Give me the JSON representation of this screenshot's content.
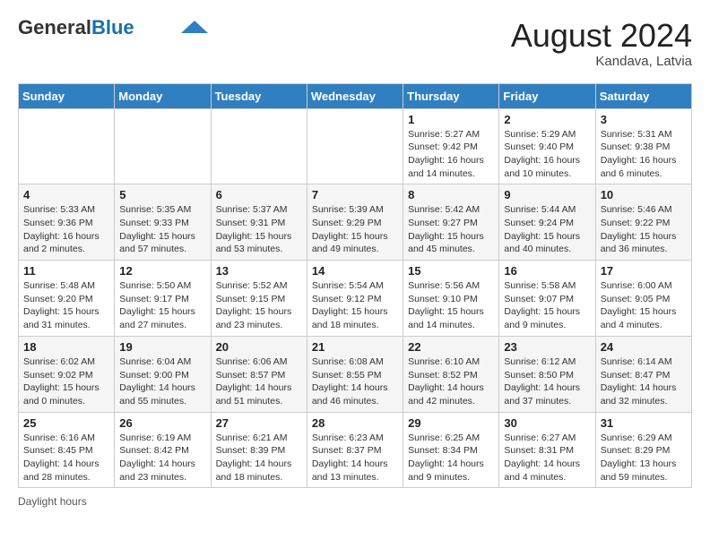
{
  "header": {
    "logo_general": "General",
    "logo_blue": "Blue",
    "month_year": "August 2024",
    "location": "Kandava, Latvia"
  },
  "footer": {
    "daylight_label": "Daylight hours"
  },
  "weekdays": [
    "Sunday",
    "Monday",
    "Tuesday",
    "Wednesday",
    "Thursday",
    "Friday",
    "Saturday"
  ],
  "weeks": [
    [
      {
        "day": "",
        "info": ""
      },
      {
        "day": "",
        "info": ""
      },
      {
        "day": "",
        "info": ""
      },
      {
        "day": "",
        "info": ""
      },
      {
        "day": "1",
        "info": "Sunrise: 5:27 AM\nSunset: 9:42 PM\nDaylight: 16 hours and 14 minutes."
      },
      {
        "day": "2",
        "info": "Sunrise: 5:29 AM\nSunset: 9:40 PM\nDaylight: 16 hours and 10 minutes."
      },
      {
        "day": "3",
        "info": "Sunrise: 5:31 AM\nSunset: 9:38 PM\nDaylight: 16 hours and 6 minutes."
      }
    ],
    [
      {
        "day": "4",
        "info": "Sunrise: 5:33 AM\nSunset: 9:36 PM\nDaylight: 16 hours and 2 minutes."
      },
      {
        "day": "5",
        "info": "Sunrise: 5:35 AM\nSunset: 9:33 PM\nDaylight: 15 hours and 57 minutes."
      },
      {
        "day": "6",
        "info": "Sunrise: 5:37 AM\nSunset: 9:31 PM\nDaylight: 15 hours and 53 minutes."
      },
      {
        "day": "7",
        "info": "Sunrise: 5:39 AM\nSunset: 9:29 PM\nDaylight: 15 hours and 49 minutes."
      },
      {
        "day": "8",
        "info": "Sunrise: 5:42 AM\nSunset: 9:27 PM\nDaylight: 15 hours and 45 minutes."
      },
      {
        "day": "9",
        "info": "Sunrise: 5:44 AM\nSunset: 9:24 PM\nDaylight: 15 hours and 40 minutes."
      },
      {
        "day": "10",
        "info": "Sunrise: 5:46 AM\nSunset: 9:22 PM\nDaylight: 15 hours and 36 minutes."
      }
    ],
    [
      {
        "day": "11",
        "info": "Sunrise: 5:48 AM\nSunset: 9:20 PM\nDaylight: 15 hours and 31 minutes."
      },
      {
        "day": "12",
        "info": "Sunrise: 5:50 AM\nSunset: 9:17 PM\nDaylight: 15 hours and 27 minutes."
      },
      {
        "day": "13",
        "info": "Sunrise: 5:52 AM\nSunset: 9:15 PM\nDaylight: 15 hours and 23 minutes."
      },
      {
        "day": "14",
        "info": "Sunrise: 5:54 AM\nSunset: 9:12 PM\nDaylight: 15 hours and 18 minutes."
      },
      {
        "day": "15",
        "info": "Sunrise: 5:56 AM\nSunset: 9:10 PM\nDaylight: 15 hours and 14 minutes."
      },
      {
        "day": "16",
        "info": "Sunrise: 5:58 AM\nSunset: 9:07 PM\nDaylight: 15 hours and 9 minutes."
      },
      {
        "day": "17",
        "info": "Sunrise: 6:00 AM\nSunset: 9:05 PM\nDaylight: 15 hours and 4 minutes."
      }
    ],
    [
      {
        "day": "18",
        "info": "Sunrise: 6:02 AM\nSunset: 9:02 PM\nDaylight: 15 hours and 0 minutes."
      },
      {
        "day": "19",
        "info": "Sunrise: 6:04 AM\nSunset: 9:00 PM\nDaylight: 14 hours and 55 minutes."
      },
      {
        "day": "20",
        "info": "Sunrise: 6:06 AM\nSunset: 8:57 PM\nDaylight: 14 hours and 51 minutes."
      },
      {
        "day": "21",
        "info": "Sunrise: 6:08 AM\nSunset: 8:55 PM\nDaylight: 14 hours and 46 minutes."
      },
      {
        "day": "22",
        "info": "Sunrise: 6:10 AM\nSunset: 8:52 PM\nDaylight: 14 hours and 42 minutes."
      },
      {
        "day": "23",
        "info": "Sunrise: 6:12 AM\nSunset: 8:50 PM\nDaylight: 14 hours and 37 minutes."
      },
      {
        "day": "24",
        "info": "Sunrise: 6:14 AM\nSunset: 8:47 PM\nDaylight: 14 hours and 32 minutes."
      }
    ],
    [
      {
        "day": "25",
        "info": "Sunrise: 6:16 AM\nSunset: 8:45 PM\nDaylight: 14 hours and 28 minutes."
      },
      {
        "day": "26",
        "info": "Sunrise: 6:19 AM\nSunset: 8:42 PM\nDaylight: 14 hours and 23 minutes."
      },
      {
        "day": "27",
        "info": "Sunrise: 6:21 AM\nSunset: 8:39 PM\nDaylight: 14 hours and 18 minutes."
      },
      {
        "day": "28",
        "info": "Sunrise: 6:23 AM\nSunset: 8:37 PM\nDaylight: 14 hours and 13 minutes."
      },
      {
        "day": "29",
        "info": "Sunrise: 6:25 AM\nSunset: 8:34 PM\nDaylight: 14 hours and 9 minutes."
      },
      {
        "day": "30",
        "info": "Sunrise: 6:27 AM\nSunset: 8:31 PM\nDaylight: 14 hours and 4 minutes."
      },
      {
        "day": "31",
        "info": "Sunrise: 6:29 AM\nSunset: 8:29 PM\nDaylight: 13 hours and 59 minutes."
      }
    ]
  ]
}
